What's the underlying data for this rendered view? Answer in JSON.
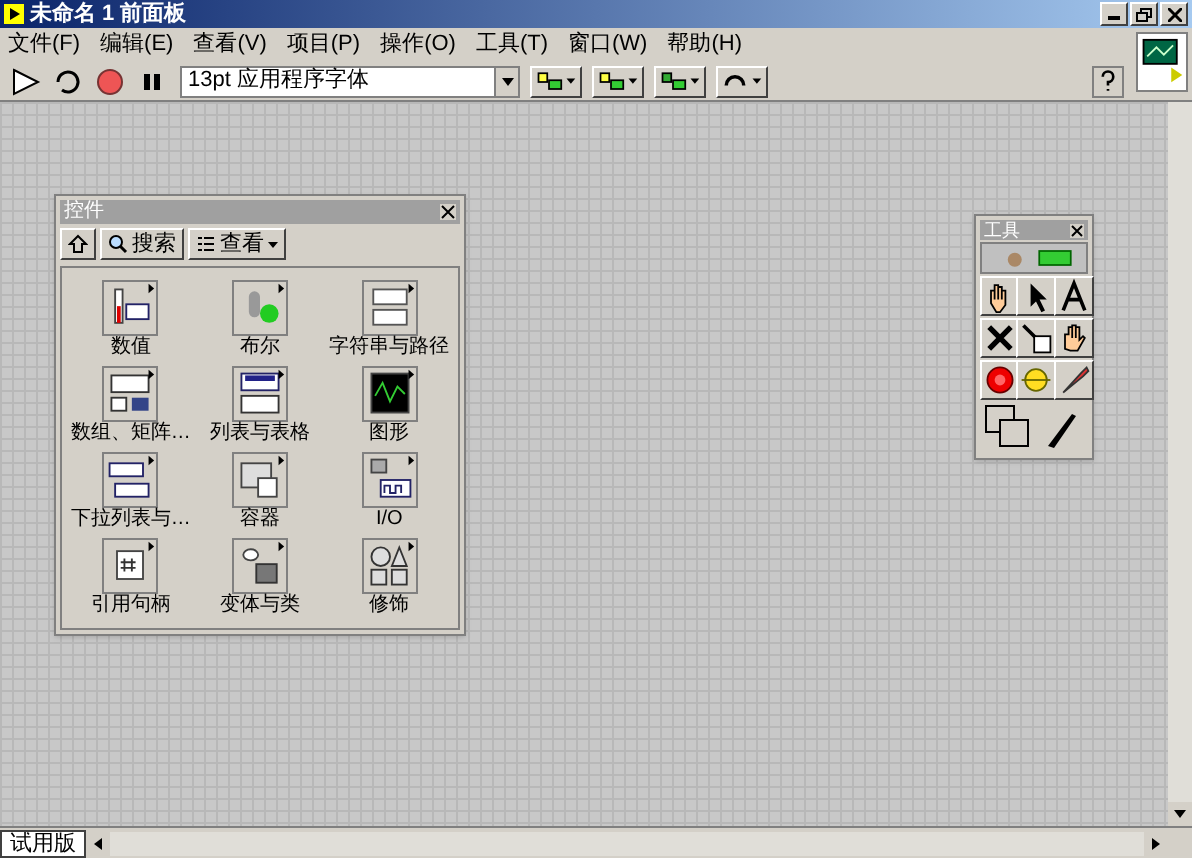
{
  "window": {
    "title": "未命名 1 前面板"
  },
  "menu": [
    "文件(F)",
    "编辑(E)",
    "查看(V)",
    "项目(P)",
    "操作(O)",
    "工具(T)",
    "窗口(W)",
    "帮助(H)"
  ],
  "toolbar": {
    "font": "13pt 应用程序字体"
  },
  "controls_palette": {
    "title": "控件",
    "search": "搜索",
    "view": "查看",
    "items": [
      {
        "label": "数值",
        "kind": "numeric"
      },
      {
        "label": "布尔",
        "kind": "boolean"
      },
      {
        "label": "字符串与路径",
        "kind": "string"
      },
      {
        "label": "数组、矩阵…",
        "kind": "array"
      },
      {
        "label": "列表与表格",
        "kind": "list"
      },
      {
        "label": "图形",
        "kind": "graph"
      },
      {
        "label": "下拉列表与…",
        "kind": "ring"
      },
      {
        "label": "容器",
        "kind": "container"
      },
      {
        "label": "I/O",
        "kind": "io"
      },
      {
        "label": "引用句柄",
        "kind": "refnum"
      },
      {
        "label": "变体与类",
        "kind": "variant"
      },
      {
        "label": "修饰",
        "kind": "decoration"
      }
    ]
  },
  "tools_palette": {
    "title": "工具"
  },
  "status_bar": {
    "tab": "试用版"
  }
}
